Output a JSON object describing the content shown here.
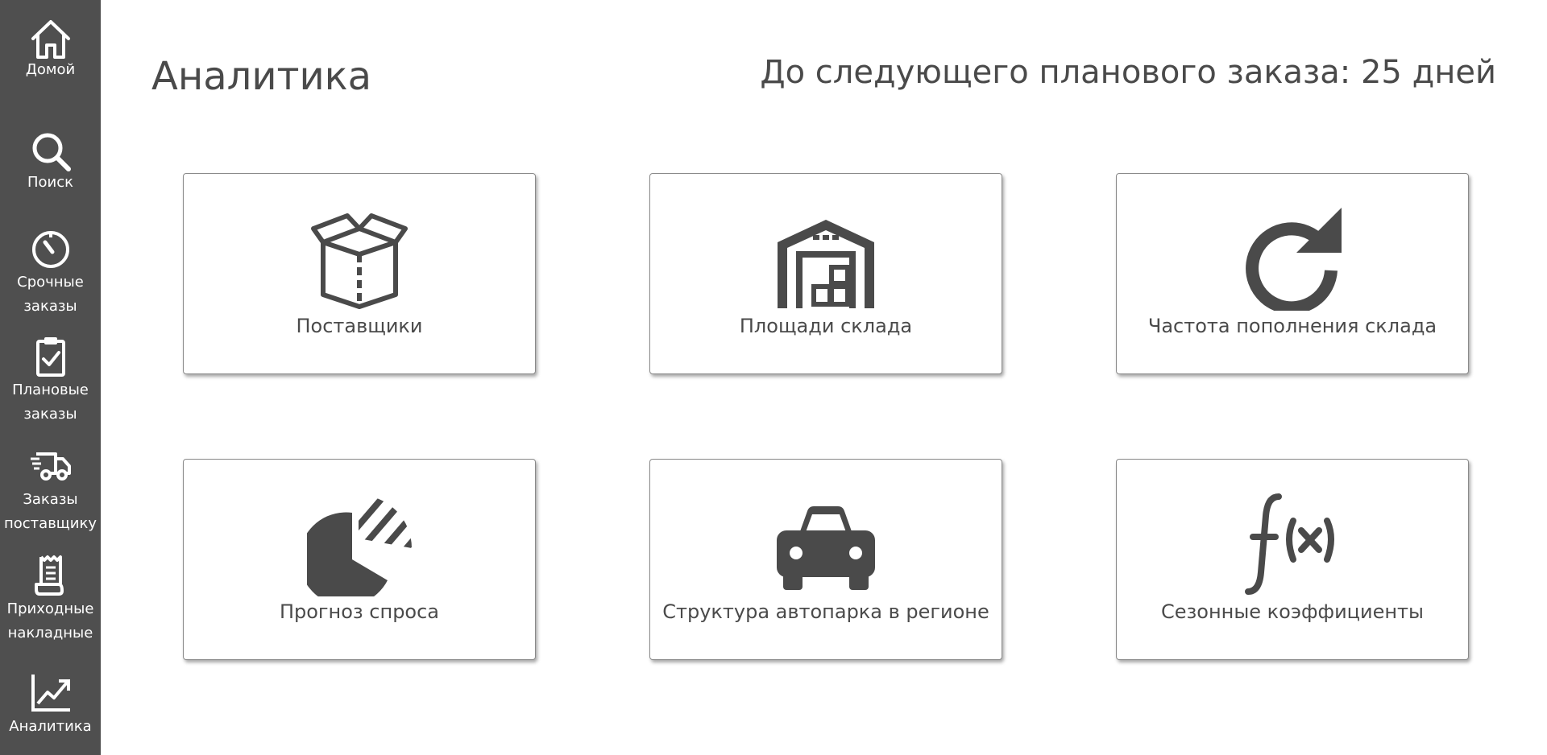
{
  "sidebar": {
    "items": [
      {
        "label_lines": [
          "Домой"
        ],
        "icon": "home-icon"
      },
      {
        "label_lines": [
          "Поиск"
        ],
        "icon": "search-icon"
      },
      {
        "label_lines": [
          "Срочные",
          "заказы"
        ],
        "icon": "timer-icon"
      },
      {
        "label_lines": [
          "Плановые",
          "заказы"
        ],
        "icon": "clipboard-check-icon"
      },
      {
        "label_lines": [
          "Заказы",
          "поставщику"
        ],
        "icon": "delivery-truck-icon"
      },
      {
        "label_lines": [
          "Приходные",
          "накладные"
        ],
        "icon": "receipt-icon"
      },
      {
        "label_lines": [
          "Аналитика"
        ],
        "icon": "trending-up-icon"
      }
    ],
    "background": "#4f4f4f"
  },
  "header": {
    "title": "Аналитика",
    "next_order": "До следующего планового заказа: 25 дней"
  },
  "cards": [
    {
      "label": "Поставщики",
      "icon": "open-box-icon"
    },
    {
      "label": "Площади склада",
      "icon": "warehouse-icon"
    },
    {
      "label": "Частота пополнения склада",
      "icon": "refresh-icon"
    },
    {
      "label": "Прогноз спроса",
      "icon": "pie-chart-forecast-icon"
    },
    {
      "label": "Структура автопарка в регионе",
      "icon": "car-icon"
    },
    {
      "label": "Сезонные коэффициенты",
      "icon": "function-icon"
    }
  ],
  "colors": {
    "icon": "#4a4a4a",
    "text": "#4a4a4a",
    "card_border": "#8a8a8a"
  }
}
